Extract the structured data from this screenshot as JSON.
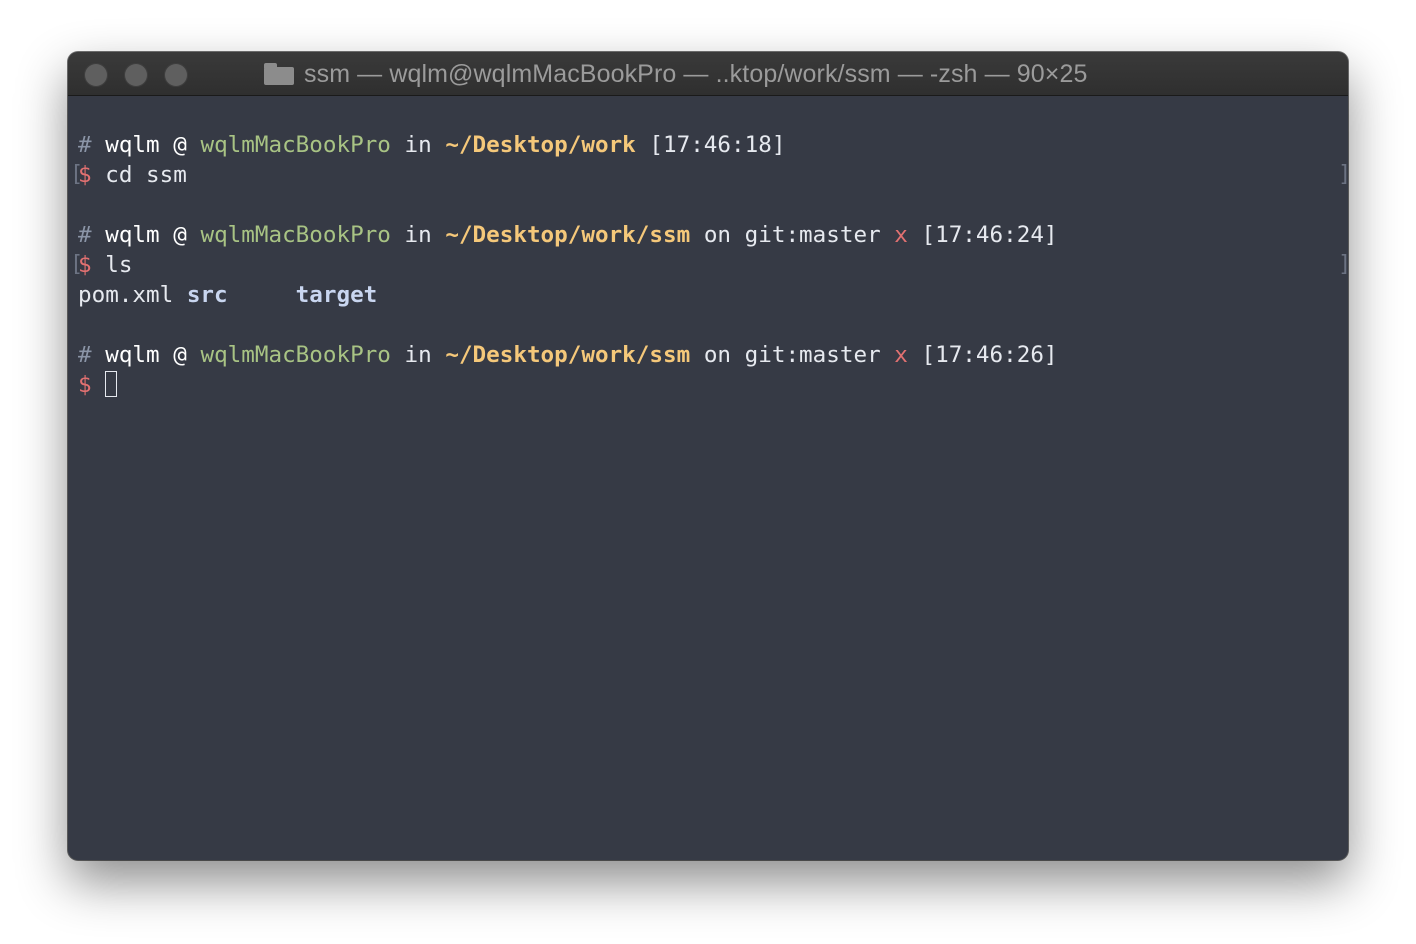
{
  "window": {
    "title": "ssm — wqlm@wqlmMacBookPro — ..ktop/work/ssm — -zsh — 90×25",
    "icon": "folder-icon"
  },
  "terminal": {
    "colors": {
      "background": "#363a45",
      "host": "#a8c384",
      "path": "#f5c87a",
      "prompt_dollar": "#e27171"
    },
    "blocks": [
      {
        "prompt": {
          "hash": "#",
          "user": "wqlm",
          "at": "@",
          "host": "wqlmMacBookPro",
          "in": "in",
          "path": "~/Desktop/work",
          "time": "[17:46:18]"
        },
        "command": {
          "dollar": "$",
          "text": "cd ssm"
        }
      },
      {
        "prompt": {
          "hash": "#",
          "user": "wqlm",
          "at": "@",
          "host": "wqlmMacBookPro",
          "in": "in",
          "path": "~/Desktop/work/ssm",
          "on": "on",
          "git": "git:master",
          "dirty": "x",
          "time": "[17:46:24]"
        },
        "command": {
          "dollar": "$",
          "text": "ls"
        },
        "output": [
          "pom.xml",
          "src",
          "target"
        ]
      },
      {
        "prompt": {
          "hash": "#",
          "user": "wqlm",
          "at": "@",
          "host": "wqlmMacBookPro",
          "in": "in",
          "path": "~/Desktop/work/ssm",
          "on": "on",
          "git": "git:master",
          "dirty": "x",
          "time": "[17:46:26]"
        },
        "command": {
          "dollar": "$",
          "text": ""
        }
      }
    ],
    "marks": {
      "left": "[",
      "right": "]"
    }
  }
}
